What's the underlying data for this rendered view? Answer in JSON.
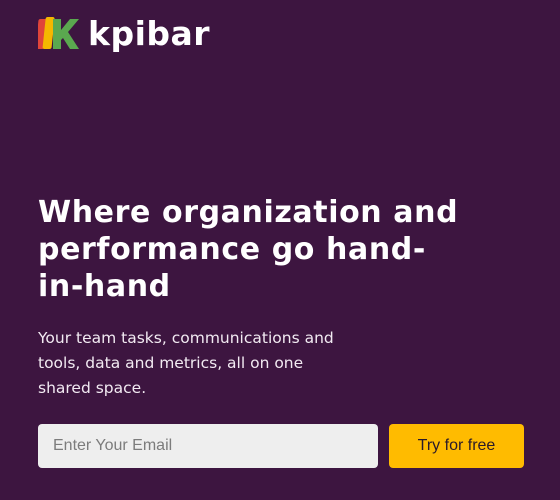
{
  "brand": {
    "name": "kpibar",
    "logo_icon": "kpibar-k-logo",
    "colors": {
      "background": "#3d1540",
      "cta": "#ffbb00",
      "logo_red": "#e0453a",
      "logo_yellow": "#f5b700",
      "logo_green": "#5aa84f"
    }
  },
  "hero": {
    "headline": "Where organization and performance go hand-in-hand",
    "subtext": "Your team tasks, communications and tools, data and metrics, all on one shared space."
  },
  "signup": {
    "email_placeholder": "Enter Your Email",
    "email_value": "",
    "cta_label": "Try for free"
  }
}
